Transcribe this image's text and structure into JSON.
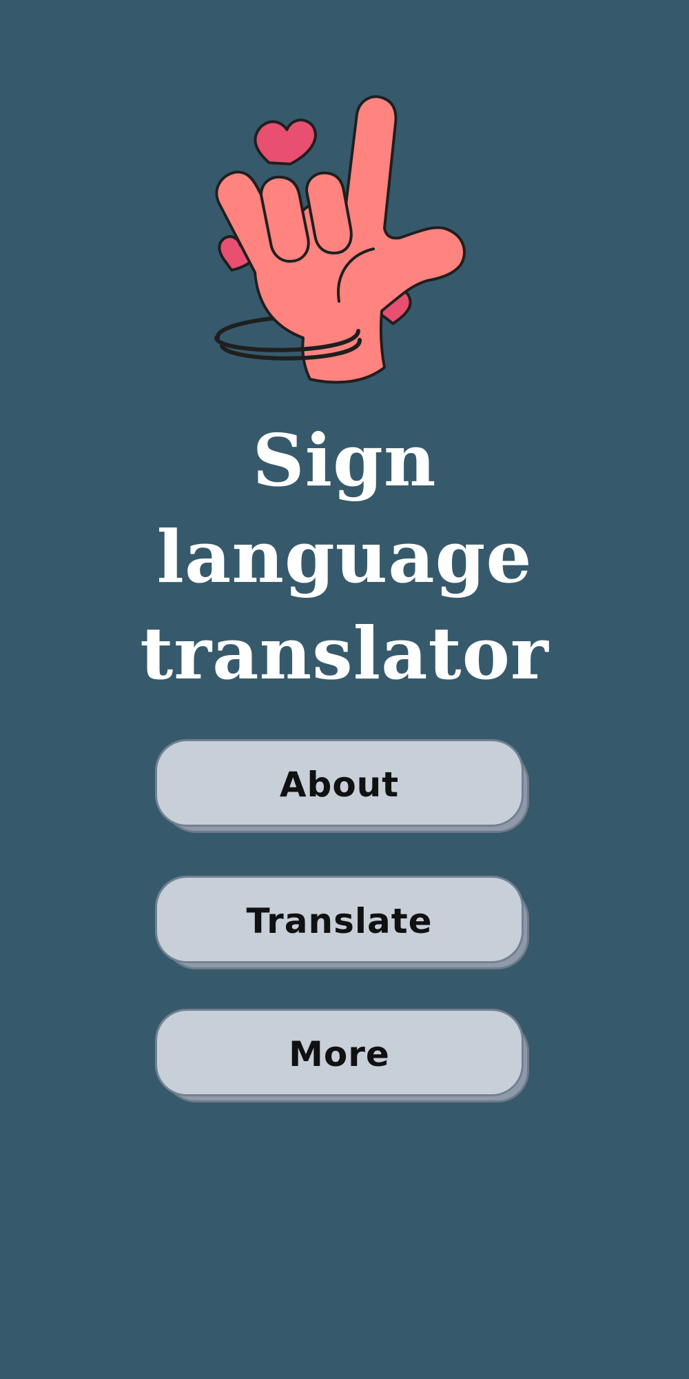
{
  "app": {
    "title_lines": [
      "Sign",
      "language",
      "translator"
    ],
    "hero_icon": "love-sign-hand-icon"
  },
  "menu": {
    "about_label": "About",
    "translate_label": "Translate",
    "more_label": "More"
  },
  "colors": {
    "background": "#365a6c",
    "title": "#ffffff",
    "button_face": "#c7cfd9",
    "button_shadow": "#8e9aa9",
    "button_border": "#738090",
    "hand": "#ff837f",
    "heart": "#e84f70",
    "outline": "#1f1f1f"
  }
}
